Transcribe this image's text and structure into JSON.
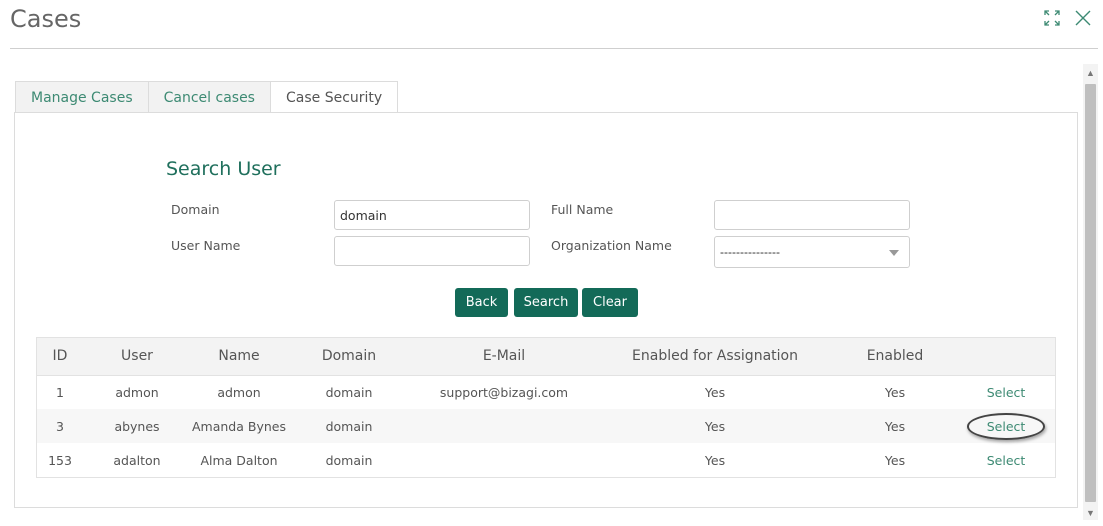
{
  "window": {
    "title": "Cases"
  },
  "tabs": [
    {
      "label": "Manage Cases"
    },
    {
      "label": "Cancel cases"
    },
    {
      "label": "Case Security"
    }
  ],
  "search": {
    "title": "Search User",
    "domain_label": "Domain",
    "domain_value": "domain",
    "fullname_label": "Full Name",
    "fullname_value": "",
    "username_label": "User Name",
    "username_value": "",
    "org_label": "Organization Name",
    "org_value": "---------------"
  },
  "buttons": {
    "back": "Back",
    "search": "Search",
    "clear": "Clear"
  },
  "table": {
    "headers": [
      "ID",
      "User",
      "Name",
      "Domain",
      "E-Mail",
      "Enabled for Assignation",
      "Enabled",
      ""
    ],
    "rows": [
      {
        "id": "1",
        "user": "admon",
        "name": "admon",
        "domain": "domain",
        "email": "support@bizagi.com",
        "assignation": "Yes",
        "enabled": "Yes",
        "action": "Select"
      },
      {
        "id": "3",
        "user": "abynes",
        "name": "Amanda Bynes",
        "domain": "domain",
        "email": "",
        "assignation": "Yes",
        "enabled": "Yes",
        "action": "Select"
      },
      {
        "id": "153",
        "user": "adalton",
        "name": "Alma Dalton",
        "domain": "domain",
        "email": "",
        "assignation": "Yes",
        "enabled": "Yes",
        "action": "Select"
      }
    ]
  },
  "colors": {
    "accent": "#136a58",
    "link": "#3d8a73"
  },
  "icons": {
    "maximize": "maximize-icon",
    "close": "close-icon"
  }
}
